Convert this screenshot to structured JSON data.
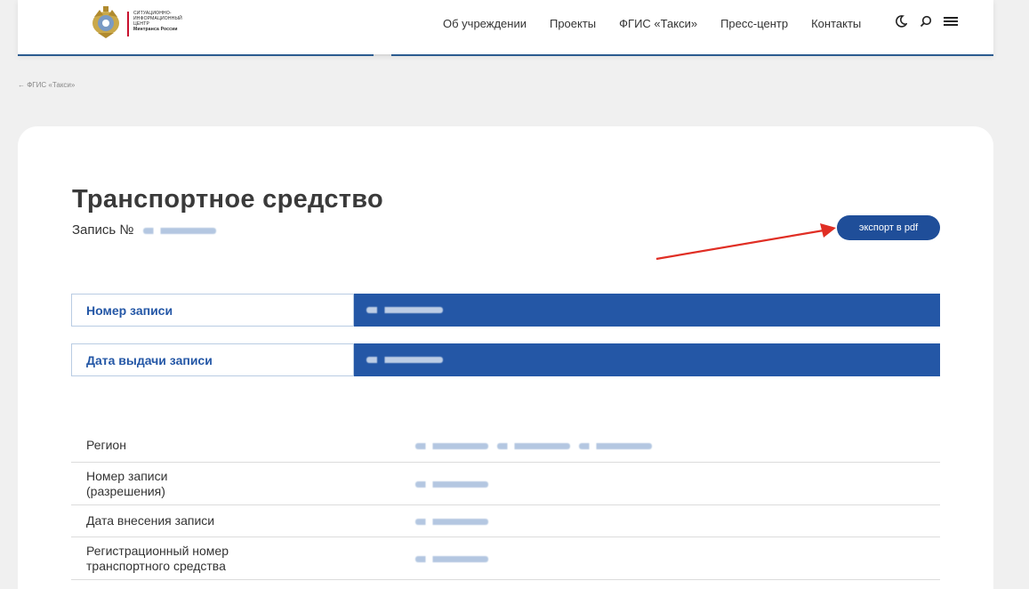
{
  "logo": {
    "line1": "СИТУАЦИОННО-",
    "line2": "ИНФОРМАЦИОННЫЙ",
    "line3": "ЦЕНТР",
    "line4": "Минтранса России"
  },
  "nav": {
    "items": [
      "Об учреждении",
      "Проекты",
      "ФГИС «Такси»",
      "Пресс-центр",
      "Контакты"
    ]
  },
  "icons": {
    "theme": "moon-icon",
    "search": "search-icon",
    "menu": "menu-icon",
    "back": "arrow-left-icon"
  },
  "breadcrumb": {
    "label": "← ФГИС «Такси»"
  },
  "page": {
    "title": "Транспортное средство",
    "record_label": "Запись №"
  },
  "export": {
    "label": "экспорт в pdf"
  },
  "summary": [
    {
      "label": "Номер записи"
    },
    {
      "label": "Дата выдачи записи"
    }
  ],
  "details": [
    {
      "label": "Регион"
    },
    {
      "label": "Номер записи (разрешения)"
    },
    {
      "label": "Дата внесения записи"
    },
    {
      "label": "Регистрационный номер транспортного средства"
    }
  ],
  "colors": {
    "accent": "#2457a6",
    "button": "#1f4e99",
    "annotation_arrow": "#e02e24"
  }
}
